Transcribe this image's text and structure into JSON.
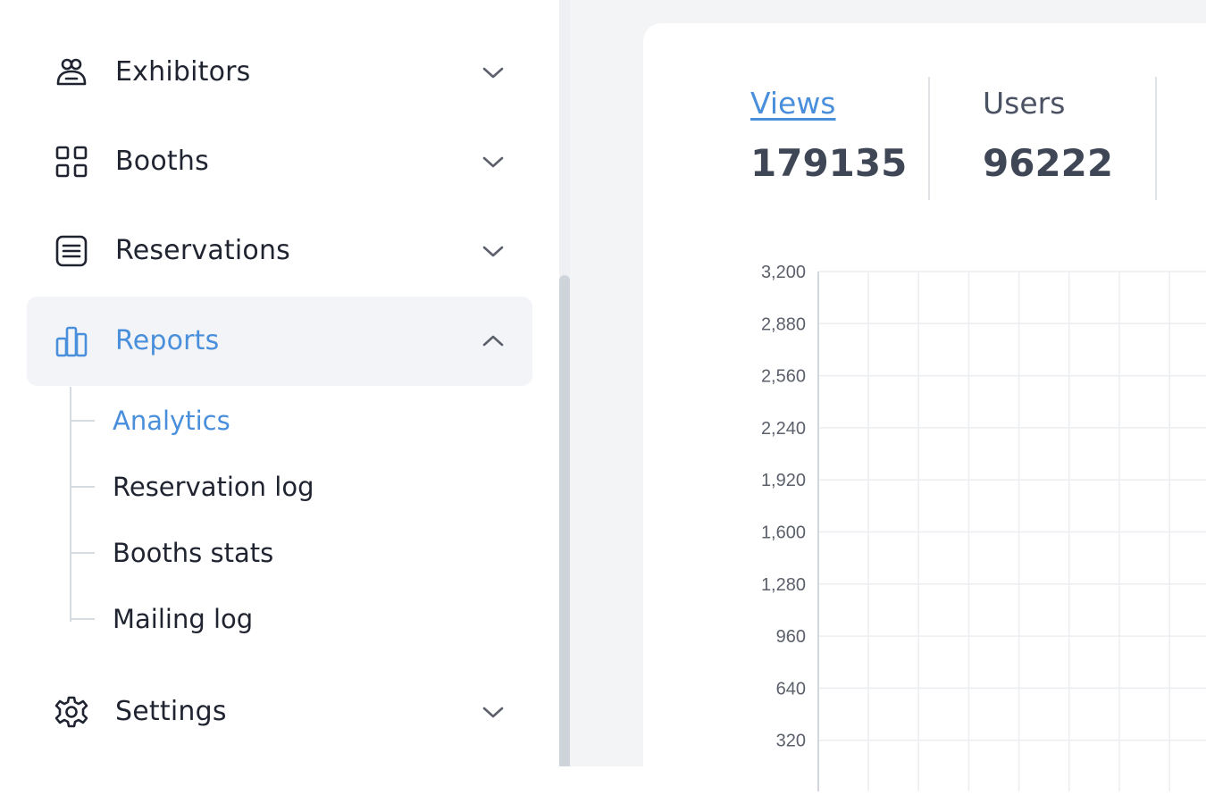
{
  "sidebar": {
    "items": [
      {
        "label": "Exhibitors",
        "icon": "exhibitors-icon",
        "expanded": false
      },
      {
        "label": "Booths",
        "icon": "grid-icon",
        "expanded": false
      },
      {
        "label": "Reservations",
        "icon": "list-icon",
        "expanded": false
      },
      {
        "label": "Reports",
        "icon": "bar-chart-icon",
        "expanded": true
      },
      {
        "label": "Settings",
        "icon": "gear-icon",
        "expanded": false
      }
    ],
    "reports_children": [
      {
        "label": "Analytics",
        "active": true
      },
      {
        "label": "Reservation log",
        "active": false
      },
      {
        "label": "Booths stats",
        "active": false
      },
      {
        "label": "Mailing log",
        "active": false
      }
    ]
  },
  "stats": [
    {
      "label": "Views",
      "value": "179135",
      "selected": true
    },
    {
      "label": "Users",
      "value": "96222",
      "selected": false
    }
  ],
  "colors": {
    "accent": "#4a8fdb",
    "active_bg": "#f2f4f7",
    "main_bg": "#f3f4f6",
    "text": "#1f2430",
    "grid": "#eceef1"
  },
  "chart_data": {
    "type": "line",
    "title": "",
    "xlabel": "",
    "ylabel": "",
    "ylim": [
      0,
      3200
    ],
    "yticks": [
      "3,200",
      "2,880",
      "2,560",
      "2,240",
      "1,920",
      "1,600",
      "1,280",
      "960",
      "640",
      "320"
    ],
    "grid": true,
    "series": []
  }
}
